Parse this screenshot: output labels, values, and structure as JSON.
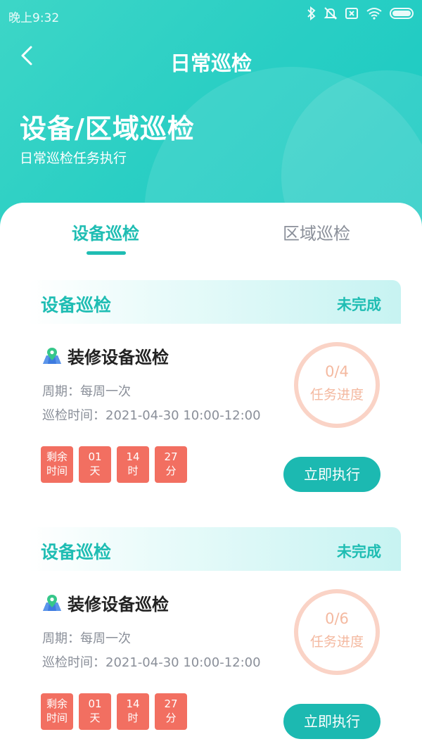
{
  "status_bar": {
    "time": "晚上9:32",
    "icons": [
      "bluetooth-icon",
      "mute-icon",
      "sim-icon",
      "wifi-icon",
      "battery-icon"
    ]
  },
  "header": {
    "title": "日常巡检",
    "hero_title": "设备/区域巡检",
    "hero_subtitle": "日常巡检任务执行"
  },
  "tabs": [
    {
      "label": "设备巡检",
      "active": true
    },
    {
      "label": "区域巡检",
      "active": false
    }
  ],
  "colors": {
    "accent": "#1fbdb3",
    "countdown": "#f26f61",
    "progress": "#f4b9a0"
  },
  "cards": [
    {
      "header_title": "设备巡检",
      "status": "未完成",
      "task_name": "装修设备巡检",
      "period": "周期：每周一次",
      "time": "巡检时间：2021-04-30 10:00-12:00",
      "countdown": {
        "label_line1": "剩余",
        "label_line2": "时间",
        "days": "01",
        "days_unit": "天",
        "hours": "14",
        "hours_unit": "时",
        "minutes": "27",
        "minutes_unit": "分"
      },
      "progress": "0/4",
      "progress_label": "任务进度",
      "button": "立即执行"
    },
    {
      "header_title": "设备巡检",
      "status": "未完成",
      "task_name": "装修设备巡检",
      "period": "周期：每周一次",
      "time": "巡检时间：2021-04-30 10:00-12:00",
      "countdown": {
        "label_line1": "剩余",
        "label_line2": "时间",
        "days": "01",
        "days_unit": "天",
        "hours": "14",
        "hours_unit": "时",
        "minutes": "27",
        "minutes_unit": "分"
      },
      "progress": "0/6",
      "progress_label": "任务进度",
      "button": "立即执行"
    }
  ]
}
